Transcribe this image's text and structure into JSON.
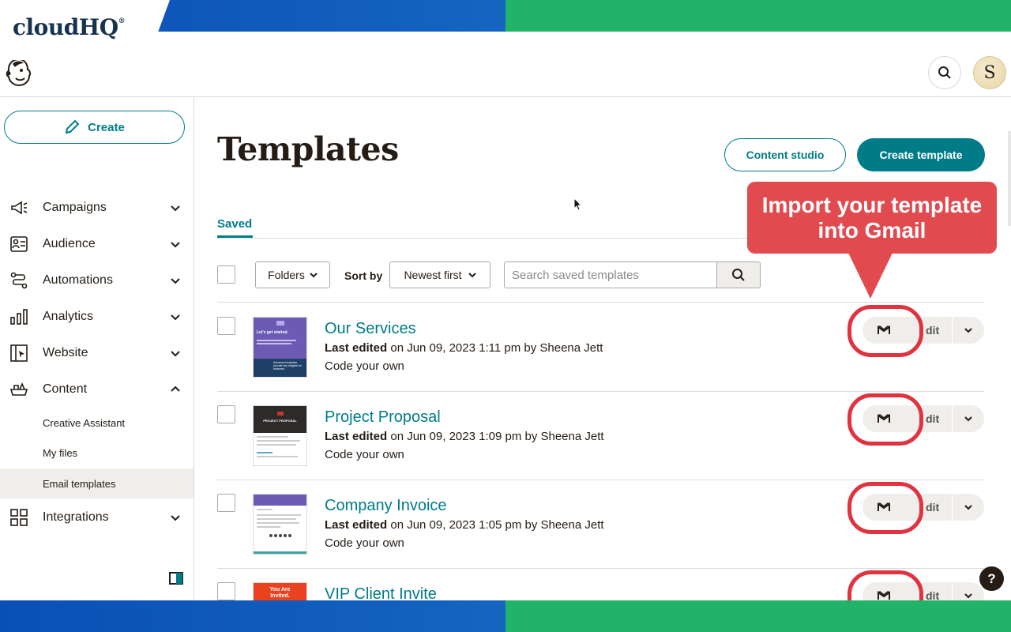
{
  "brand": {
    "name": "cloudHQ",
    "reg": "®"
  },
  "header": {
    "avatar_initial": "S"
  },
  "sidebar": {
    "create_label": "Create",
    "items": [
      {
        "label": "Campaigns",
        "icon": "megaphone-icon",
        "expanded": false
      },
      {
        "label": "Audience",
        "icon": "audience-icon",
        "expanded": false
      },
      {
        "label": "Automations",
        "icon": "automation-icon",
        "expanded": false
      },
      {
        "label": "Analytics",
        "icon": "bar-chart-icon",
        "expanded": false
      },
      {
        "label": "Website",
        "icon": "website-icon",
        "expanded": false
      },
      {
        "label": "Content",
        "icon": "content-icon",
        "expanded": true
      },
      {
        "label": "Integrations",
        "icon": "grid-icon",
        "expanded": false
      }
    ],
    "content_sub": [
      "Creative Assistant",
      "My files",
      "Email templates"
    ],
    "active_sub": "Email templates"
  },
  "page": {
    "title": "Templates",
    "content_studio_label": "Content studio",
    "create_template_label": "Create template",
    "tab_saved": "Saved"
  },
  "toolbar": {
    "folders_label": "Folders",
    "sort_by_label": "Sort by",
    "sort_value": "Newest first",
    "search_placeholder": "Search saved templates"
  },
  "templates": [
    {
      "title": "Our Services",
      "meta_bold": "Last edited",
      "meta_rest": " on Jun 09, 2023 1:11 pm by Sheena Jett",
      "type": "Code your own",
      "edit_label": "dit"
    },
    {
      "title": "Project Proposal",
      "meta_bold": "Last edited",
      "meta_rest": " on Jun 09, 2023 1:09 pm by Sheena Jett",
      "type": "Code your own",
      "edit_label": "dit"
    },
    {
      "title": "Company Invoice",
      "meta_bold": "Last edited",
      "meta_rest": " on Jun 09, 2023 1:05 pm by Sheena Jett",
      "type": "Code your own",
      "edit_label": "dit"
    },
    {
      "title": "VIP Client Invite",
      "meta_bold": "",
      "meta_rest": "",
      "type": "",
      "edit_label": "dit"
    }
  ],
  "thumbnails": {
    "services": {
      "heading": "Let's get started.",
      "footer": "Advanced analytics provide key insights for business"
    },
    "proposal": {
      "heading": "PROJECT PROPOSAL"
    },
    "invite": {
      "heading": "You Are Invited."
    }
  },
  "callout": {
    "line1": "Import your template",
    "line2": "into Gmail"
  },
  "help_label": "?",
  "colors": {
    "accent": "#007c89",
    "callout": "#e14b4f",
    "ring": "#e0323f",
    "band_blue": "#0a4fb6",
    "band_green": "#22b36a"
  }
}
